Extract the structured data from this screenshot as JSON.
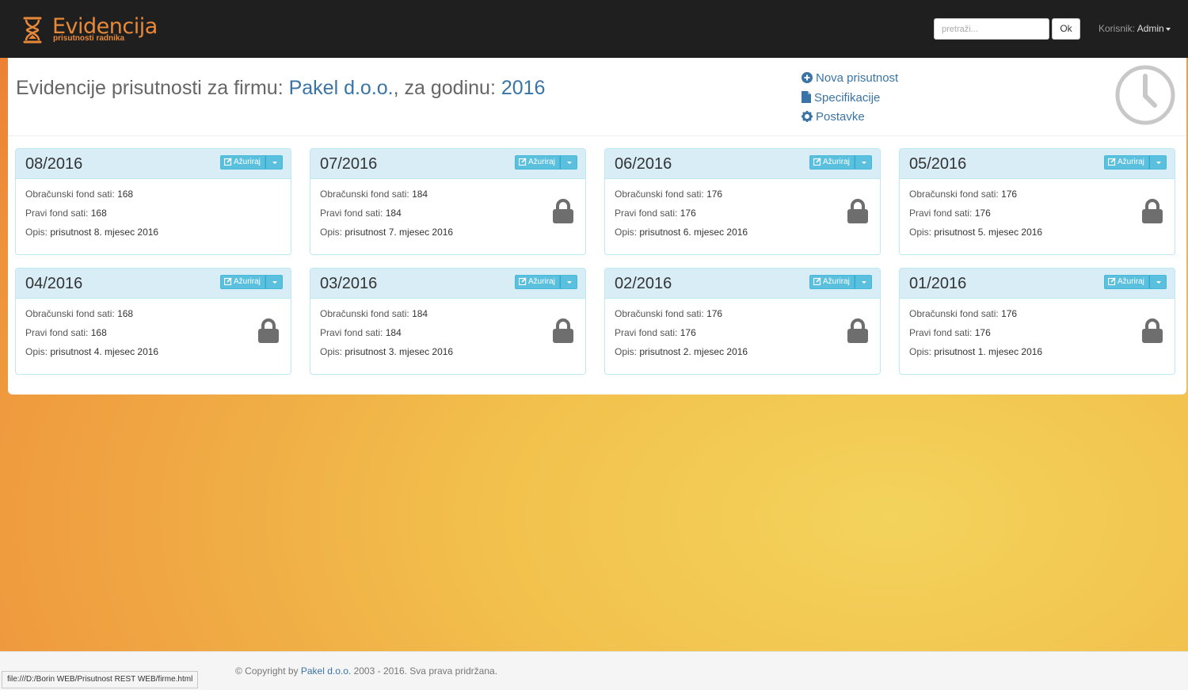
{
  "app": {
    "title": "Evidencija",
    "subtitle": "prisutnosti radnika",
    "brand_color": "#e8893a"
  },
  "navbar": {
    "search_placeholder": "pretraži...",
    "search_button": "Ok",
    "user_label": "Korisnik:",
    "user_name": "Admin"
  },
  "header": {
    "title_prefix": "Evidencije prisutnosti za firmu: ",
    "company": "Pakel d.o.o.",
    "title_middle": ", za godinu: ",
    "year": "2016",
    "actions": [
      {
        "label": "Nova prisutnost",
        "icon": "plus-circle-icon"
      },
      {
        "label": "Specifikacije",
        "icon": "file-icon"
      },
      {
        "label": "Postavke",
        "icon": "gear-icon"
      }
    ]
  },
  "labels": {
    "update_button": "Ažuriraj",
    "fund_calc": "Obračunski fond sati:",
    "fund_real": "Pravi fond sati:",
    "description": "Opis:"
  },
  "periods": [
    {
      "period": "08/2016",
      "calc": "168",
      "real": "168",
      "desc": "prisutnost 8. mjesec 2016",
      "locked": false
    },
    {
      "period": "07/2016",
      "calc": "184",
      "real": "184",
      "desc": "prisutnost 7. mjesec 2016",
      "locked": true
    },
    {
      "period": "06/2016",
      "calc": "176",
      "real": "176",
      "desc": "prisutnost 6. mjesec 2016",
      "locked": true
    },
    {
      "period": "05/2016",
      "calc": "176",
      "real": "176",
      "desc": "prisutnost 5. mjesec 2016",
      "locked": true
    },
    {
      "period": "04/2016",
      "calc": "168",
      "real": "168",
      "desc": "prisutnost 4. mjesec 2016",
      "locked": true
    },
    {
      "period": "03/2016",
      "calc": "184",
      "real": "184",
      "desc": "prisutnost 3. mjesec 2016",
      "locked": true
    },
    {
      "period": "02/2016",
      "calc": "176",
      "real": "176",
      "desc": "prisutnost 2. mjesec 2016",
      "locked": true
    },
    {
      "period": "01/2016",
      "calc": "176",
      "real": "176",
      "desc": "prisutnost 1. mjesec 2016",
      "locked": true
    }
  ],
  "footer": {
    "prefix": "© Copyright by ",
    "company": "Pakel d.o.o.",
    "suffix": " 2003 - 2016. Sva prava pridržana."
  },
  "statusbar": {
    "url": "file:///D:/Borin WEB/Prisutnost REST WEB/firme.html"
  }
}
